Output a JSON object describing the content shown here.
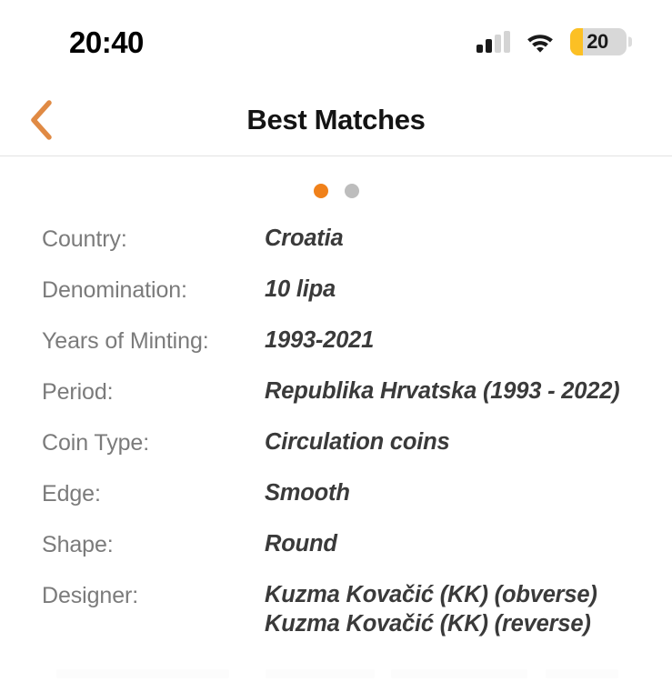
{
  "status_bar": {
    "time": "20:40",
    "signal_icon": "cellular-signal-icon",
    "signal_bars_filled": 2,
    "signal_bars_total": 4,
    "wifi_icon": "wifi-icon",
    "battery_icon": "battery-icon",
    "battery_level": "20",
    "battery_fill_color": "#fcc024"
  },
  "nav_bar": {
    "back_icon": "chevron-left-icon",
    "back_color": "#e08a44",
    "title": "Best Matches"
  },
  "pager": {
    "active_color": "#f0811a",
    "inactive_color": "#bdbdbd",
    "dots": [
      {
        "name": "page-dot-1",
        "active": true
      },
      {
        "name": "page-dot-2",
        "active": false
      }
    ]
  },
  "details": {
    "rows": [
      {
        "name": "country",
        "label": "Country:",
        "value": "Croatia"
      },
      {
        "name": "denomination",
        "label": "Denomination:",
        "value": "10 lipa"
      },
      {
        "name": "years-of-minting",
        "label": "Years of Minting:",
        "value": "1993-2021"
      },
      {
        "name": "period",
        "label": "Period:",
        "value": "Republika Hrvatska (1993 - 2022)"
      },
      {
        "name": "coin-type",
        "label": "Coin Type:",
        "value": "Circulation coins"
      },
      {
        "name": "edge",
        "label": "Edge:",
        "value": "Smooth"
      },
      {
        "name": "shape",
        "label": "Shape:",
        "value": "Round"
      },
      {
        "name": "designer",
        "label": "Designer:",
        "value": "Kuzma Kovačić (KK) (obverse)\nKuzma Kovačić (KK) (reverse)"
      }
    ]
  }
}
